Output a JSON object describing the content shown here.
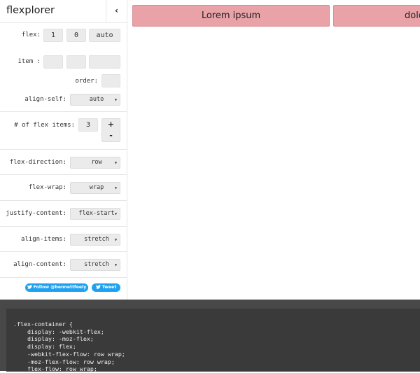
{
  "app": {
    "title": "flexplorer",
    "collapse_label": "‹"
  },
  "item_settings": {
    "flex_label": "flex:",
    "flex_grow": "1",
    "flex_shrink": "0",
    "flex_basis": "auto",
    "item_label": "item :",
    "item_field_1": "",
    "item_field_2": "",
    "item_field_3": "",
    "order_label": "order:",
    "order_value": "",
    "align_self_label": "align-self:",
    "align_self_value": "auto"
  },
  "flex_items": {
    "label": "# of flex items:",
    "count": "3",
    "plus_label": "+",
    "minus_label": "-"
  },
  "container_settings": [
    {
      "label": "flex-direction:",
      "value": "row"
    },
    {
      "label": "flex-wrap:",
      "value": "wrap"
    },
    {
      "label": "justify-content:",
      "value": "flex-start"
    },
    {
      "label": "align-items:",
      "value": "stretch"
    },
    {
      "label": "align-content:",
      "value": "stretch"
    }
  ],
  "social": {
    "follow_label": "Follow @bennettfeely",
    "tweet_label": "Tweet",
    "color": "#1da1f2"
  },
  "stage": {
    "items": [
      {
        "text": "Lorem ipsum"
      },
      {
        "text": "dolo"
      }
    ],
    "item_color": "#e8a2a8"
  },
  "code": {
    "lines": [
      ".flex-container {",
      "    display: -webkit-flex;",
      "    display: -moz-flex;",
      "    display: flex;",
      "    -webkit-flex-flow: row wrap;",
      "    -moz-flex-flow: row wrap;",
      "    flex-flow: row wrap;"
    ]
  }
}
